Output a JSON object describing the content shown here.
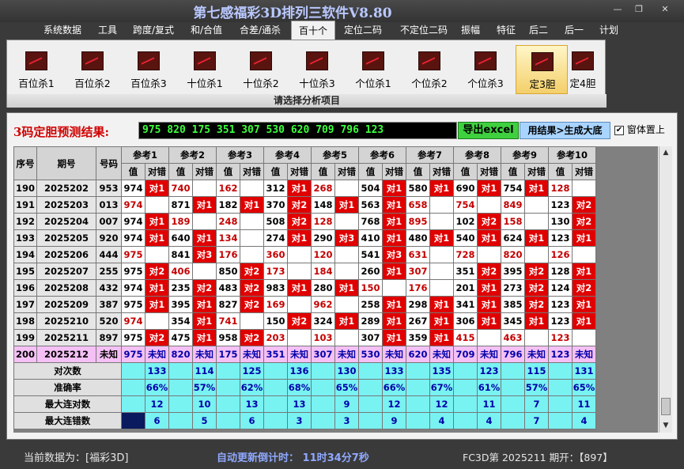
{
  "window": {
    "title": "第七感福彩3D排列三软件V8.80",
    "min": "—",
    "restore": "❐",
    "close": "✕"
  },
  "menu": [
    "系统数据",
    "工具",
    "跨度/复式",
    "和/合值",
    "合差/通杀",
    "百十个",
    "定位二码",
    "不定位二码",
    "振幅",
    "特征",
    "后二",
    "后一",
    "计划"
  ],
  "menu_active": 5,
  "ribbon": {
    "buttons": [
      "百位杀1",
      "百位杀2",
      "百位杀3",
      "十位杀1",
      "十位杀2",
      "十位杀3",
      "个位杀1",
      "个位杀2",
      "个位杀3",
      "定3胆",
      "定4胆"
    ],
    "active": 9,
    "caption": "请选择分析项目"
  },
  "result": {
    "label": "3码定胆预测结果:",
    "value": "975 820 175 351 307 530 620 709 796 123",
    "export_button": "导出excel",
    "generate_button": "用结果>生成大底",
    "topmost_label": "窗体置上",
    "topmost_checked": "✔"
  },
  "table": {
    "headers": {
      "seq": "序号",
      "issue": "期号",
      "num": "号码",
      "value": "值",
      "hit": "对错",
      "refs": [
        "参考1",
        "参考2",
        "参考3",
        "参考4",
        "参考5",
        "参考6",
        "参考7",
        "参考8",
        "参考9",
        "参考10"
      ]
    },
    "rows": [
      {
        "seq": "190",
        "issue": "2025202",
        "num": "953",
        "cells": [
          [
            "974",
            "对1"
          ],
          [
            "740",
            ""
          ],
          [
            "162",
            ""
          ],
          [
            "312",
            "对1"
          ],
          [
            "268",
            ""
          ],
          [
            "504",
            "对1"
          ],
          [
            "580",
            "对1"
          ],
          [
            "690",
            "对1"
          ],
          [
            "754",
            "对1"
          ],
          [
            "128",
            ""
          ]
        ]
      },
      {
        "seq": "191",
        "issue": "2025203",
        "num": "013",
        "cells": [
          [
            "974",
            ""
          ],
          [
            "871",
            "对1"
          ],
          [
            "182",
            "对1"
          ],
          [
            "370",
            "对2"
          ],
          [
            "148",
            "对1"
          ],
          [
            "563",
            "对1"
          ],
          [
            "658",
            ""
          ],
          [
            "754",
            ""
          ],
          [
            "849",
            ""
          ],
          [
            "123",
            "对2"
          ]
        ]
      },
      {
        "seq": "192",
        "issue": "2025204",
        "num": "007",
        "cells": [
          [
            "974",
            "对1"
          ],
          [
            "189",
            ""
          ],
          [
            "248",
            ""
          ],
          [
            "508",
            "对2"
          ],
          [
            "128",
            ""
          ],
          [
            "768",
            "对1"
          ],
          [
            "895",
            ""
          ],
          [
            "102",
            "对2"
          ],
          [
            "158",
            ""
          ],
          [
            "130",
            "对2"
          ]
        ]
      },
      {
        "seq": "193",
        "issue": "2025205",
        "num": "920",
        "cells": [
          [
            "974",
            "对1"
          ],
          [
            "640",
            "对1"
          ],
          [
            "134",
            ""
          ],
          [
            "274",
            "对1"
          ],
          [
            "290",
            "对3"
          ],
          [
            "410",
            "对1"
          ],
          [
            "480",
            "对1"
          ],
          [
            "540",
            "对1"
          ],
          [
            "624",
            "对1"
          ],
          [
            "123",
            "对1"
          ]
        ]
      },
      {
        "seq": "194",
        "issue": "2025206",
        "num": "444",
        "cells": [
          [
            "975",
            ""
          ],
          [
            "841",
            "对3"
          ],
          [
            "176",
            ""
          ],
          [
            "360",
            ""
          ],
          [
            "120",
            ""
          ],
          [
            "541",
            "对3"
          ],
          [
            "631",
            ""
          ],
          [
            "728",
            ""
          ],
          [
            "820",
            ""
          ],
          [
            "126",
            ""
          ]
        ]
      },
      {
        "seq": "195",
        "issue": "2025207",
        "num": "255",
        "cells": [
          [
            "975",
            "对2"
          ],
          [
            "406",
            ""
          ],
          [
            "850",
            "对2"
          ],
          [
            "173",
            ""
          ],
          [
            "184",
            ""
          ],
          [
            "260",
            "对1"
          ],
          [
            "307",
            ""
          ],
          [
            "351",
            "对2"
          ],
          [
            "395",
            "对2"
          ],
          [
            "128",
            "对1"
          ]
        ]
      },
      {
        "seq": "196",
        "issue": "2025208",
        "num": "432",
        "cells": [
          [
            "974",
            "对1"
          ],
          [
            "235",
            "对2"
          ],
          [
            "483",
            "对2"
          ],
          [
            "983",
            "对1"
          ],
          [
            "280",
            "对1"
          ],
          [
            "150",
            ""
          ],
          [
            "176",
            ""
          ],
          [
            "201",
            "对1"
          ],
          [
            "273",
            "对2"
          ],
          [
            "124",
            "对2"
          ]
        ]
      },
      {
        "seq": "197",
        "issue": "2025209",
        "num": "387",
        "cells": [
          [
            "975",
            "对1"
          ],
          [
            "395",
            "对1"
          ],
          [
            "827",
            "对2"
          ],
          [
            "169",
            ""
          ],
          [
            "962",
            ""
          ],
          [
            "258",
            "对1"
          ],
          [
            "298",
            "对1"
          ],
          [
            "341",
            "对1"
          ],
          [
            "385",
            "对2"
          ],
          [
            "123",
            "对1"
          ]
        ]
      },
      {
        "seq": "198",
        "issue": "2025210",
        "num": "520",
        "cells": [
          [
            "974",
            ""
          ],
          [
            "354",
            "对1"
          ],
          [
            "741",
            ""
          ],
          [
            "150",
            "对2"
          ],
          [
            "324",
            "对1"
          ],
          [
            "289",
            "对1"
          ],
          [
            "267",
            "对1"
          ],
          [
            "306",
            "对1"
          ],
          [
            "345",
            "对1"
          ],
          [
            "123",
            "对1"
          ]
        ]
      },
      {
        "seq": "199",
        "issue": "2025211",
        "num": "897",
        "cells": [
          [
            "975",
            "对2"
          ],
          [
            "475",
            "对1"
          ],
          [
            "958",
            "对2"
          ],
          [
            "203",
            ""
          ],
          [
            "103",
            ""
          ],
          [
            "307",
            "对1"
          ],
          [
            "359",
            "对1"
          ],
          [
            "415",
            ""
          ],
          [
            "463",
            ""
          ],
          [
            "123",
            ""
          ]
        ]
      }
    ],
    "pred_row": {
      "seq": "200",
      "issue": "2025212",
      "num": "未知",
      "values": [
        "975",
        "820",
        "175",
        "351",
        "307",
        "530",
        "620",
        "709",
        "796",
        "123"
      ],
      "hit": "未知"
    },
    "stats": [
      {
        "label": "对次数",
        "values": [
          "133",
          "114",
          "125",
          "136",
          "130",
          "133",
          "135",
          "123",
          "115",
          "131"
        ]
      },
      {
        "label": "准确率",
        "values": [
          "66%",
          "57%",
          "62%",
          "68%",
          "65%",
          "66%",
          "67%",
          "61%",
          "57%",
          "65%"
        ]
      },
      {
        "label": "最大连对数",
        "values": [
          "12",
          "10",
          "13",
          "13",
          "9",
          "12",
          "12",
          "11",
          "7",
          "11"
        ]
      },
      {
        "label": "最大连错数",
        "values": [
          "6",
          "5",
          "6",
          "3",
          "3",
          "9",
          "4",
          "4",
          "7",
          "4"
        ]
      }
    ]
  },
  "status": {
    "current": "当前数据为：[福彩3D]",
    "countdown": "自动更新倒计时：  11时34分7秒",
    "issue": "FC3D第  2025211  期开：【897】"
  },
  "colors": {
    "hit": "#e00000",
    "stat_bg": "#79f2f2",
    "pred_bg": "#f5c0f5",
    "result_text": "#3cff3c"
  }
}
